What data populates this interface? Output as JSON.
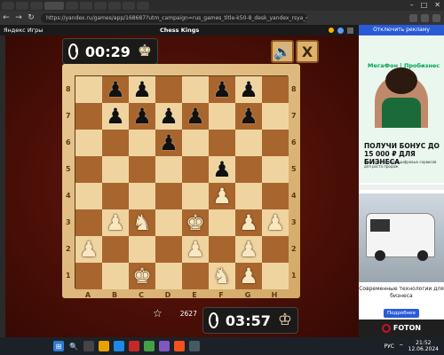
{
  "browser": {
    "url": "https://yandex.ru/games/app/168687?utm_campaign=rus_games_title-k50-8_desk_yandex_rsya_460.new%7C6446157..."
  },
  "header": {
    "brand": "Яндекс Игры",
    "game_title": "Chess Kings"
  },
  "game": {
    "opponent_timer": "00:29",
    "player_timer": "03:57",
    "sound_icon": "speaker-icon",
    "close_label": "X",
    "rating": "2627",
    "files": [
      "A",
      "B",
      "C",
      "D",
      "E",
      "F",
      "G",
      "H"
    ],
    "ranks": [
      "8",
      "7",
      "6",
      "5",
      "4",
      "3",
      "2",
      "1"
    ],
    "board": [
      [
        "",
        "bp",
        "bp",
        "",
        "",
        "bp",
        "bp",
        ""
      ],
      [
        "",
        "bp",
        "bp",
        "bp",
        "bp",
        "",
        "bp",
        ""
      ],
      [
        "",
        "",
        "",
        "bp",
        "",
        "",
        "",
        ""
      ],
      [
        "",
        "",
        "",
        "",
        "",
        "bp",
        "",
        ""
      ],
      [
        "",
        "",
        "",
        "",
        "",
        "wp",
        "",
        ""
      ],
      [
        "",
        "wp",
        "wn",
        "",
        "wk",
        "",
        "wp",
        "wp"
      ],
      [
        "wp",
        "",
        "",
        "",
        "wp",
        "",
        "wp",
        ""
      ],
      [
        "",
        "",
        "wk",
        "",
        "",
        "wn",
        "wp",
        ""
      ]
    ]
  },
  "ad": {
    "top_button": "Отключить рекламу",
    "megafon_logo": "МегаФон | Пробизнес",
    "megafon_headline": "ПОЛУЧИ БОНУС ДО 15 000 ₽ ДЛЯ БИЗНЕСА",
    "megafon_sub": "При подключении цифровых сервисов для роста продаж",
    "foton_text": "Современные технологии для бизнеса",
    "foton_button": "Подробнее",
    "foton_brand": "FOTON"
  },
  "taskbar": {
    "lang": "РУС",
    "time": "21:52",
    "date": "12.06.2024"
  }
}
